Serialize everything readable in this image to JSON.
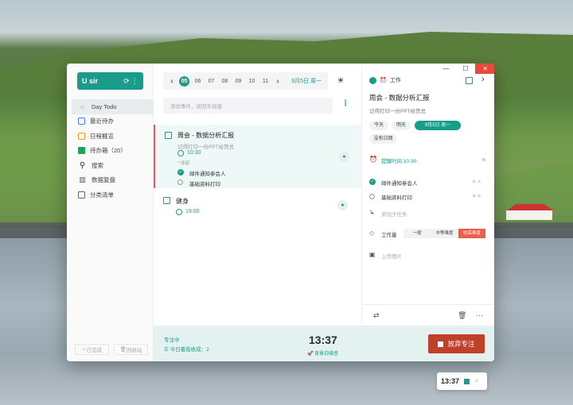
{
  "sidebar": {
    "user": "U sir",
    "items": [
      {
        "label": "Day Todo",
        "icon": "sun-icon"
      },
      {
        "label": "最近待办",
        "icon": "calendar-icon"
      },
      {
        "label": "日程概览",
        "icon": "calendar-overview-icon"
      },
      {
        "label": "待办箱（20）",
        "icon": "inbox-icon"
      },
      {
        "label": "搜索",
        "icon": "search-icon"
      },
      {
        "label": "数据复盘",
        "icon": "chart-icon"
      },
      {
        "label": "分类清单",
        "icon": "list-icon"
      }
    ],
    "footer": {
      "done": "已完成",
      "trash": "回收站"
    }
  },
  "datebar": {
    "days": [
      "05",
      "06",
      "07",
      "08",
      "09",
      "10",
      "11"
    ],
    "selected": "05",
    "label": "9月5日 周一"
  },
  "add_input": {
    "placeholder": "添加事件，按回车创建"
  },
  "tasks": [
    {
      "title": "周会 - 数据分析汇报",
      "note": "记得打印一份PPT给贺总",
      "time": "10:30",
      "collapse": "收起",
      "subtasks": [
        {
          "label": "邮件通知参会人",
          "done": true
        },
        {
          "label": "基础资料打印",
          "done": false
        }
      ]
    },
    {
      "title": "健身",
      "time": "19:00"
    }
  ],
  "focus": {
    "status": "专注中",
    "count": "今日番茄收成：2",
    "clock": "13:37",
    "noise": "背景白噪音",
    "give_up": "放弃专注"
  },
  "detail": {
    "category": "工作",
    "title": "周会 - 数据分析汇报",
    "note": "记得打印一份PPT给贺总",
    "dates": [
      "今天",
      "明天",
      "9月5日 周一"
    ],
    "no_date": "没有日期",
    "reminder": "提醒时间 10:30",
    "subtasks": [
      "邮件通知参会人",
      "基础资料打印"
    ],
    "add_subtask": "添加子任务",
    "workload_label": "工作量",
    "difficulty": [
      "一般",
      "中等难度",
      "较高难度"
    ],
    "upload": "上传图片"
  },
  "mini_timer": {
    "clock": "13:37"
  },
  "colors": {
    "accent": "#1a9c8a",
    "danger": "#c0402a",
    "high": "#e8604c"
  }
}
